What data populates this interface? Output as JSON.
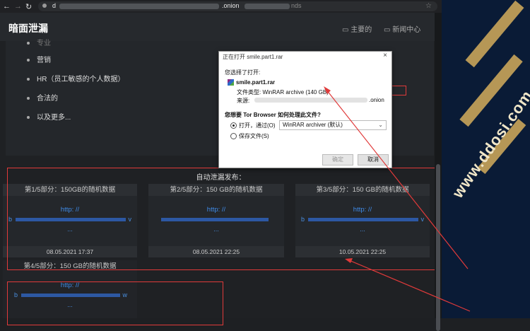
{
  "browser": {
    "url_prefix": "d",
    "url_mid": ".onion",
    "url_suffix": "nds"
  },
  "header": {
    "site_title": "暗面泄漏",
    "nav": [
      {
        "label": "主要的"
      },
      {
        "label": "新闻中心"
      }
    ]
  },
  "top_list": {
    "partial_item": "专业",
    "items": [
      "营销",
      "HR（员工敏感的个人数据）",
      "合法的",
      "以及更多..."
    ]
  },
  "release_section": {
    "title": "自动泄漏发布：",
    "cards": [
      {
        "head": "第1/5部分：150GB的随机数据",
        "http": "http: //",
        "prefix": "b",
        "suffix": "v",
        "ellipsis": "...",
        "date": "08.05.2021 17:37"
      },
      {
        "head": "第2/5部分：150 GB的随机数据",
        "http": "http: //",
        "prefix": "",
        "suffix": "",
        "ellipsis": "...",
        "date": "08.05.2021 22:25"
      },
      {
        "head": "第3/5部分：150 GB的随机数据",
        "http": "http: //",
        "prefix": "b",
        "suffix": "v",
        "ellipsis": "...",
        "date": "10.05.2021 22:25"
      },
      {
        "head": "第4/5部分：150 GB的随机数据",
        "http": "http: //",
        "prefix": "b",
        "suffix": "w",
        "ellipsis": "...",
        "date": ""
      }
    ]
  },
  "dialog": {
    "title": "正在打开 smile.part1.rar",
    "close": "×",
    "chosen_label": "您选择了打开:",
    "filename": "smile.part1.rar",
    "filetype_label": "文件类型:",
    "filetype_value": "WinRAR archive (140 GB)",
    "source_label": "来源:",
    "source_suffix": ".onion",
    "question": "您想要 Tor Browser 如何处理此文件?",
    "open_with_label": "打开，通过(O)",
    "open_with_value": "WinRAR archiver (默认)",
    "save_label": "保存文件(S)",
    "ok": "确定",
    "cancel": "取消"
  },
  "watermark": {
    "text": "www.ddosi.com"
  },
  "colors": {
    "link": "#3f8be8",
    "annotation": "#e03a3a"
  }
}
